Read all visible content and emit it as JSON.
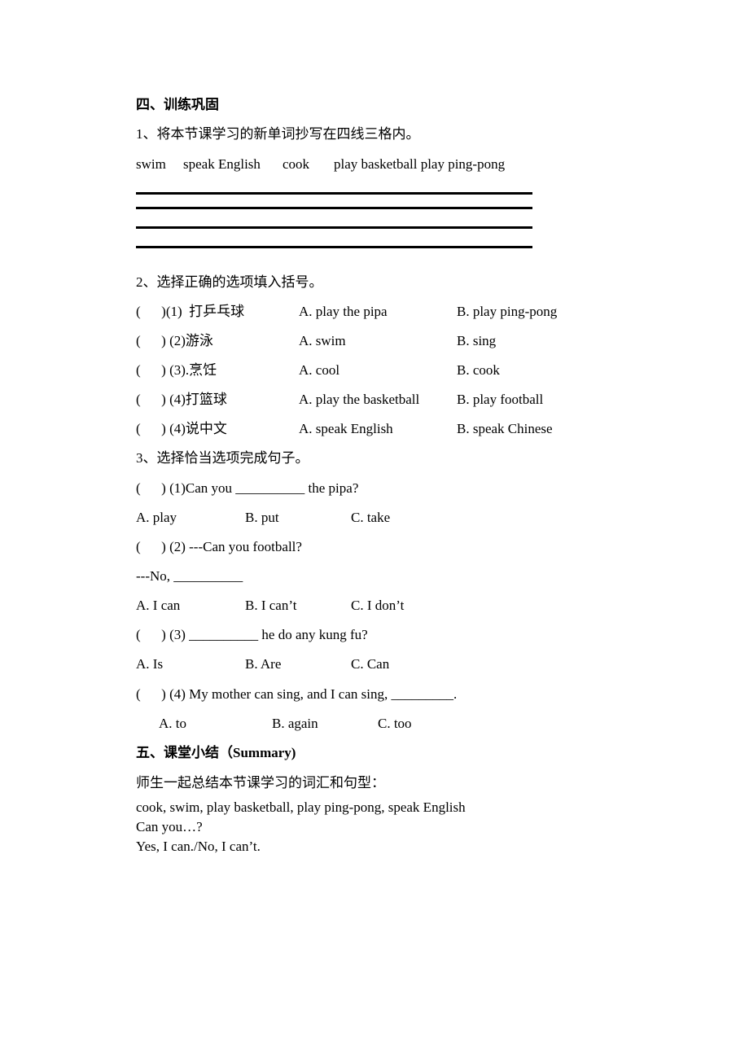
{
  "section4": {
    "heading": "四、训练巩固",
    "q1": {
      "title": "1、将本节课学习的新单词抄写在四线三格内。",
      "words": [
        "swim",
        "speak English",
        "cook",
        "play basketball play ping-pong"
      ]
    },
    "q2": {
      "title": "2、选择正确的选项填入括号。",
      "items": [
        {
          "paren": "(      )(1)  打乒乓球",
          "a": "A. play the pipa",
          "b": "B. play ping-pong"
        },
        {
          "paren": "(      ) (2)游泳",
          "a": "A. swim",
          "b": "B. sing"
        },
        {
          "paren": "(      ) (3).烹饪",
          "a": "A. cool",
          "b": "B. cook"
        },
        {
          "paren": "(      ) (4)打篮球",
          "a": "A. play the basketball",
          "b": "B. play football"
        },
        {
          "paren": "(      ) (4)说中文",
          "a": "A. speak English",
          "b": "B. speak Chinese"
        }
      ]
    },
    "q3": {
      "title": "3、选择恰当选项完成句子。",
      "q1_stem": "(      ) (1)Can you __________ the pipa?",
      "q1_options": [
        "A. play",
        "B. put",
        "C. take"
      ],
      "q2_stem": "(      ) (2) ---Can you football?",
      "q2_reply": "---No, __________",
      "q2_options": [
        "A. I can",
        "B. I can’t",
        "C. I don’t"
      ],
      "q3_stem": "(      ) (3) __________ he do any kung fu?",
      "q3_options": [
        "A. Is",
        "B. Are",
        "C. Can"
      ],
      "q4_stem": "(      ) (4) My mother can sing, and I can sing, _________.",
      "q4_options": [
        "A. to",
        "B. again",
        "C. too"
      ]
    }
  },
  "section5": {
    "heading": "五、课堂小结（Summary)",
    "intro": "师生一起总结本节课学习的词汇和句型：",
    "vocab": "cook, swim, play basketball, play ping-pong, speak English",
    "pattern1": "Can you…?",
    "pattern2": "Yes, I can./No, I can’t."
  }
}
